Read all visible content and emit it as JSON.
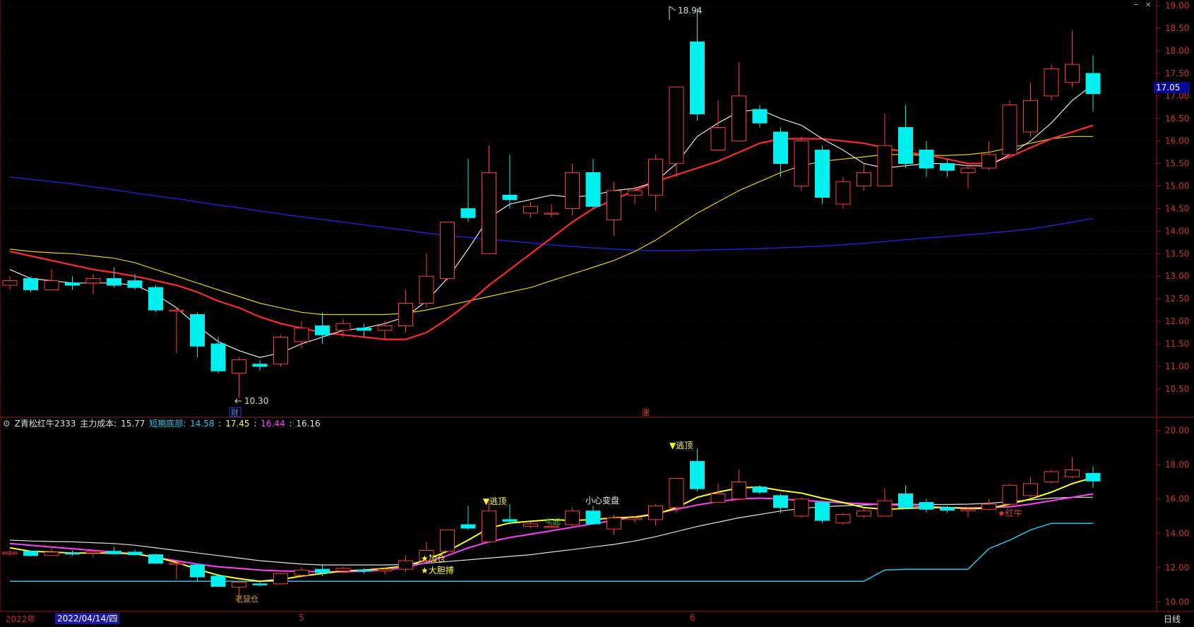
{
  "colors": {
    "up": "#ff3a3a",
    "down": "#00f0f0",
    "ma5": "#e8e8e8",
    "ma10": "#ff2a2a",
    "ma20": "#e8d200",
    "ma60": "#2020d0",
    "grid": "#5a0000",
    "axis_text": "#cc3333",
    "main_cost": "#ff40ff",
    "short_bottom": "#20c8f0",
    "line_yellow": "#ffff20",
    "line_white": "#e0e0e0"
  },
  "main_panel": {
    "y_ticks": [
      "19.00",
      "18.50",
      "18.00",
      "17.50",
      "17.00",
      "16.50",
      "16.00",
      "15.50",
      "15.00",
      "14.50",
      "14.00",
      "13.50",
      "13.00",
      "12.50",
      "12.00",
      "11.50",
      "11.00",
      "10.50"
    ],
    "ylim": [
      10.2,
      19.05
    ],
    "high_label": "18.94",
    "low_label": "10.30",
    "current_price": "17.05",
    "event_markers": [
      "财",
      "涨"
    ]
  },
  "sub_panel": {
    "indicator_name": "Z青松红牛2333",
    "main_cost_label": "主力成本:",
    "main_cost_value": "15.77",
    "short_bottom_label": "短期底部:",
    "short_bottom_value": "14.58",
    "v3": "17.45",
    "v4": "16.44",
    "v5": "16.16",
    "sep": ":",
    "y_ticks": [
      "20.00",
      "18.00",
      "16.00",
      "14.00",
      "12.00",
      "10.00"
    ],
    "ylim": [
      9.6,
      20.4
    ],
    "signals": {
      "escape_top_1": "▼逃顶",
      "escape_top_2": "▼逃顶",
      "caution": "小心变盘",
      "add_position": "★加仓",
      "bold_bottom": "★大胆搏",
      "red_bull": "★红牛",
      "cow_start": "牛起",
      "bottom_hint": "老鼠仓"
    }
  },
  "bottom_bar": {
    "year": "2022年",
    "cursor_date": "2022/04/14/四",
    "month_5": "5",
    "month_6": "6",
    "period": "日线"
  },
  "chart_data": {
    "type": "candlestick",
    "series": [
      {
        "values": [
          [
            12.8,
            12.9,
            12.7,
            13.0
          ],
          [
            12.95,
            12.7,
            12.65,
            13.0
          ],
          [
            12.7,
            12.9,
            12.7,
            13.15
          ],
          [
            12.85,
            12.8,
            12.7,
            13.0
          ],
          [
            12.85,
            12.95,
            12.6,
            13.05
          ],
          [
            12.95,
            12.8,
            12.75,
            13.2
          ],
          [
            12.9,
            12.75,
            12.7,
            13.05
          ],
          [
            12.75,
            12.25,
            12.2,
            12.8
          ],
          [
            12.25,
            12.25,
            11.3,
            12.3
          ],
          [
            12.15,
            11.45,
            11.2,
            12.2
          ],
          [
            11.5,
            10.9,
            10.85,
            11.65
          ],
          [
            10.85,
            11.15,
            10.3,
            11.2
          ],
          [
            11.05,
            11.0,
            10.9,
            11.15
          ],
          [
            11.05,
            11.65,
            11.0,
            11.7
          ],
          [
            11.55,
            11.85,
            11.4,
            12.0
          ],
          [
            11.9,
            11.7,
            11.5,
            12.2
          ],
          [
            11.8,
            11.95,
            11.65,
            12.05
          ],
          [
            11.85,
            11.8,
            11.65,
            11.95
          ],
          [
            11.8,
            11.9,
            11.6,
            12.0
          ],
          [
            11.9,
            12.4,
            11.75,
            12.7
          ],
          [
            12.4,
            13.0,
            12.3,
            13.5
          ],
          [
            12.95,
            14.2,
            12.9,
            14.2
          ],
          [
            14.5,
            14.3,
            14.2,
            15.6
          ],
          [
            13.5,
            15.3,
            13.5,
            15.9
          ],
          [
            14.8,
            14.7,
            14.5,
            15.7
          ],
          [
            14.4,
            14.55,
            14.3,
            14.65
          ],
          [
            14.4,
            14.4,
            14.3,
            14.6
          ],
          [
            14.5,
            15.3,
            14.35,
            15.5
          ],
          [
            15.3,
            14.55,
            14.5,
            15.6
          ],
          [
            14.25,
            14.9,
            13.9,
            15.1
          ],
          [
            14.8,
            14.9,
            14.6,
            15.0
          ],
          [
            14.8,
            15.6,
            14.45,
            15.7
          ],
          [
            15.5,
            17.2,
            15.2,
            17.2
          ],
          [
            18.2,
            16.6,
            16.45,
            18.94
          ],
          [
            15.8,
            16.3,
            15.8,
            16.9
          ],
          [
            16.0,
            17.0,
            16.0,
            17.75
          ],
          [
            16.7,
            16.4,
            16.3,
            16.8
          ],
          [
            16.2,
            15.5,
            15.2,
            16.3
          ],
          [
            15.0,
            16.0,
            14.9,
            16.1
          ],
          [
            15.8,
            14.75,
            14.6,
            15.9
          ],
          [
            14.6,
            15.1,
            14.5,
            15.2
          ],
          [
            15.0,
            15.3,
            14.9,
            15.5
          ],
          [
            15.0,
            15.9,
            15.0,
            16.6
          ],
          [
            16.3,
            15.5,
            15.4,
            16.8
          ],
          [
            15.8,
            15.4,
            15.2,
            16.0
          ],
          [
            15.5,
            15.35,
            15.2,
            15.6
          ],
          [
            15.3,
            15.4,
            14.95,
            15.5
          ],
          [
            15.4,
            15.7,
            15.35,
            16.0
          ],
          [
            15.7,
            16.8,
            15.7,
            16.9
          ],
          [
            16.2,
            16.9,
            16.1,
            17.3
          ],
          [
            17.0,
            17.6,
            16.9,
            17.7
          ],
          [
            17.3,
            17.7,
            17.2,
            18.45
          ],
          [
            17.5,
            17.05,
            16.65,
            17.9
          ]
        ]
      },
      {
        "name": "MA5",
        "values": [
          13.15,
          12.95,
          12.9,
          12.85,
          12.85,
          12.85,
          12.8,
          12.6,
          12.3,
          11.9,
          11.55,
          11.35,
          11.2,
          11.3,
          11.5,
          11.65,
          11.8,
          11.85,
          11.95,
          12.1,
          12.45,
          12.95,
          13.6,
          14.3,
          14.6,
          14.7,
          14.8,
          14.75,
          14.8,
          14.9,
          14.95,
          15.1,
          15.5,
          16.1,
          16.4,
          16.65,
          16.7,
          16.5,
          16.35,
          16.05,
          15.8,
          15.5,
          15.4,
          15.45,
          15.5,
          15.5,
          15.45,
          15.45,
          15.7,
          16.0,
          16.4,
          16.9,
          17.25
        ]
      },
      {
        "name": "MA10",
        "values": [
          13.55,
          13.45,
          13.35,
          13.25,
          13.15,
          13.08,
          13.0,
          12.9,
          12.8,
          12.65,
          12.45,
          12.3,
          12.1,
          11.95,
          11.85,
          11.75,
          11.7,
          11.65,
          11.6,
          11.6,
          11.75,
          12.05,
          12.4,
          12.8,
          13.15,
          13.5,
          13.85,
          14.2,
          14.5,
          14.7,
          14.9,
          15.1,
          15.25,
          15.4,
          15.55,
          15.75,
          15.95,
          16.05,
          16.05,
          16.05,
          16.0,
          15.95,
          15.85,
          15.75,
          15.7,
          15.6,
          15.5,
          15.5,
          15.65,
          15.85,
          16.05,
          16.2,
          16.35
        ]
      },
      {
        "name": "MA20",
        "values": [
          13.6,
          13.55,
          13.52,
          13.5,
          13.45,
          13.4,
          13.3,
          13.15,
          13.0,
          12.85,
          12.7,
          12.55,
          12.4,
          12.3,
          12.2,
          12.15,
          12.15,
          12.15,
          12.15,
          12.18,
          12.25,
          12.35,
          12.45,
          12.55,
          12.65,
          12.75,
          12.9,
          13.05,
          13.2,
          13.35,
          13.55,
          13.8,
          14.1,
          14.4,
          14.65,
          14.9,
          15.1,
          15.3,
          15.45,
          15.55,
          15.6,
          15.65,
          15.7,
          15.7,
          15.68,
          15.68,
          15.7,
          15.75,
          15.85,
          15.95,
          16.05,
          16.1,
          16.1
        ]
      },
      {
        "name": "MA60",
        "values": [
          15.2,
          15.15,
          15.1,
          15.05,
          14.98,
          14.92,
          14.85,
          14.78,
          14.72,
          14.65,
          14.58,
          14.52,
          14.45,
          14.38,
          14.32,
          14.26,
          14.2,
          14.14,
          14.08,
          14.02,
          13.96,
          13.9,
          13.86,
          13.82,
          13.78,
          13.74,
          13.7,
          13.66,
          13.63,
          13.6,
          13.58,
          13.57,
          13.57,
          13.58,
          13.59,
          13.6,
          13.61,
          13.63,
          13.65,
          13.67,
          13.7,
          13.73,
          13.77,
          13.81,
          13.85,
          13.88,
          13.92,
          13.96,
          14.0,
          14.05,
          14.12,
          14.2,
          14.28
        ]
      },
      {
        "name": "主力成本",
        "values": [
          13.4,
          13.3,
          13.2,
          13.1,
          13.0,
          12.9,
          12.8,
          12.6,
          12.4,
          12.2,
          12.05,
          11.95,
          11.85,
          11.8,
          11.78,
          11.76,
          11.75,
          11.78,
          11.85,
          12.0,
          12.3,
          12.7,
          13.15,
          13.5,
          13.75,
          13.95,
          14.15,
          14.35,
          14.55,
          14.75,
          14.95,
          15.15,
          15.4,
          15.65,
          15.85,
          16.0,
          16.05,
          16.0,
          15.92,
          15.85,
          15.78,
          15.72,
          15.68,
          15.62,
          15.56,
          15.5,
          15.48,
          15.5,
          15.55,
          15.7,
          15.9,
          16.1,
          16.3
        ]
      },
      {
        "name": "短期底部",
        "values": [
          11.2,
          11.2,
          11.2,
          11.2,
          11.2,
          11.2,
          11.2,
          11.2,
          11.2,
          11.2,
          11.2,
          11.2,
          11.2,
          11.2,
          11.2,
          11.2,
          11.2,
          11.2,
          11.2,
          11.2,
          11.2,
          11.2,
          11.2,
          11.2,
          11.2,
          11.2,
          11.2,
          11.2,
          11.2,
          11.2,
          11.2,
          11.2,
          11.2,
          11.2,
          11.2,
          11.2,
          11.2,
          11.2,
          11.2,
          11.2,
          11.2,
          11.2,
          11.85,
          11.9,
          11.9,
          11.9,
          11.9,
          13.1,
          13.6,
          14.2,
          14.58,
          14.58,
          14.58
        ]
      }
    ]
  }
}
